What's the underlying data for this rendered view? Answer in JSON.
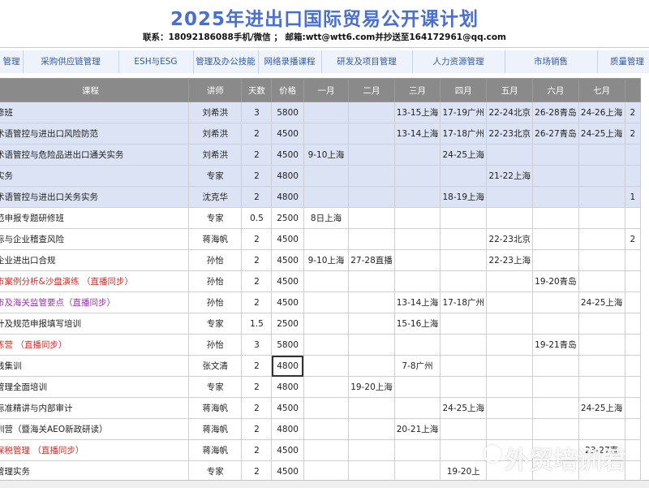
{
  "title": "2025年进出口国际贸易公开课计划",
  "contact": "联系：18092186088手机/微信 ； 邮箱:wtt@wtt6.com并抄送至164172961@qq.com",
  "tabs": [
    "管理",
    "采购供应链管理",
    "ESH与ESG",
    "管理及办公技能",
    "网络录播课程",
    "研发及项目管理",
    "人力资源管理",
    "市场销售",
    "质量管理"
  ],
  "headers": [
    "课程",
    "讲师",
    "天数",
    "价格",
    "一月",
    "二月",
    "三月",
    "四月",
    "五月",
    "六月",
    "七月",
    ""
  ],
  "rows": [
    {
      "course": "修班",
      "style": "",
      "blue": true,
      "cells": [
        "刘希洪",
        "3",
        "5800",
        "",
        "",
        "13-15上海",
        "17-19广州",
        "22-24北京",
        "26-28青岛",
        "24-26上海",
        "2"
      ]
    },
    {
      "course": "术语管控与进出口风险防范",
      "style": "",
      "blue": true,
      "cells": [
        "刘希洪",
        "2",
        "4500",
        "",
        "",
        "13-14上海",
        "17-18广州",
        "22-23北京",
        "26-27青岛",
        "24-25上海",
        "2"
      ]
    },
    {
      "course": "术语管控与危险品进出口通关实务",
      "style": "",
      "blue": true,
      "cells": [
        "刘希洪",
        "2",
        "4500",
        "9-10上海",
        "",
        "",
        "24-25上海",
        "",
        "",
        "",
        ""
      ]
    },
    {
      "course": "实务",
      "style": "",
      "blue": true,
      "cells": [
        "专家",
        "2",
        "4800",
        "",
        "",
        "",
        "",
        "21-22上海",
        "",
        "",
        ""
      ]
    },
    {
      "course": "术语管控与进出口关务实务",
      "style": "",
      "blue": true,
      "cells": [
        "沈克华",
        "2",
        "4800",
        "",
        "",
        "",
        "18-19上海",
        "",
        "",
        "",
        "1"
      ]
    },
    {
      "course": "范申报专题研修班",
      "style": "",
      "blue": false,
      "cells": [
        "专家",
        "0.5",
        "2500",
        "8日上海",
        "",
        "",
        "",
        "",
        "",
        "",
        ""
      ]
    },
    {
      "course": "际与企业稽查风险",
      "style": "",
      "blue": false,
      "cells": [
        "蒋海帆",
        "2",
        "4500",
        "",
        "",
        "",
        "",
        "22-23北京",
        "",
        "",
        "2"
      ]
    },
    {
      "course": "企业进出口合规",
      "style": "",
      "blue": false,
      "cells": [
        "孙怡",
        "2",
        "4500",
        "9-10上海",
        "27-28直播",
        "",
        "",
        "22-23上海",
        "",
        "",
        ""
      ]
    },
    {
      "course": "市案例分析&沙盘演练 （直播同步）",
      "style": "red",
      "blue": false,
      "cells": [
        "孙怡",
        "2",
        "4500",
        "",
        "",
        "",
        "",
        "",
        "19-20青岛",
        "",
        ""
      ]
    },
    {
      "course": "市及海关监管要点（直播同步）",
      "style": "purple",
      "blue": false,
      "cells": [
        "孙怡",
        "2",
        "4500",
        "",
        "",
        "13-14上海",
        "17-18广州",
        "",
        "",
        "24-25上海",
        ""
      ]
    },
    {
      "course": "计及规范申报填写培训",
      "style": "",
      "blue": false,
      "cells": [
        "专家",
        "1.5",
        "2500",
        "",
        "",
        "15-16上海",
        "",
        "",
        "",
        "",
        ""
      ]
    },
    {
      "course": "练营 （直播同步）",
      "style": "red",
      "blue": false,
      "cells": [
        "孙怡",
        "3",
        "5800",
        "",
        "",
        "",
        "",
        "",
        "19-21青岛",
        "",
        ""
      ]
    },
    {
      "course": "践集训",
      "style": "",
      "blue": false,
      "cells": [
        "张文清",
        "2",
        "4800",
        "",
        "",
        "7-8广州",
        "",
        "",
        "",
        "",
        ""
      ]
    },
    {
      "course": "管理全面培训",
      "style": "",
      "blue": false,
      "cells": [
        "专家",
        "2",
        "4800",
        "",
        "19-20上海",
        "",
        "",
        "",
        "",
        "",
        ""
      ]
    },
    {
      "course": "标准精讲与内部审计",
      "style": "",
      "blue": false,
      "cells": [
        "蒋海帆",
        "2",
        "4500",
        "",
        "",
        "",
        "24-25上海",
        "",
        "",
        "24-25上海",
        ""
      ]
    },
    {
      "course": "训营（暨海关AEO新政研读）",
      "style": "",
      "blue": false,
      "cells": [
        "蒋海帆",
        "2",
        "4800",
        "",
        "",
        "20-21上海",
        "",
        "",
        "",
        "",
        ""
      ]
    },
    {
      "course": "保税管理 （直播同步）",
      "style": "red",
      "blue": false,
      "cells": [
        "蒋海帆",
        "2",
        "4500",
        "",
        "",
        "",
        "",
        "",
        "",
        "23-27直",
        ""
      ]
    },
    {
      "course": "管理实务",
      "style": "",
      "blue": false,
      "cells": [
        "专家",
        "2",
        "4500",
        "",
        "",
        "",
        "19-20上",
        "",
        "",
        "",
        ""
      ]
    }
  ],
  "watermark": "外贸培训君",
  "watermark_icon": "chat-bubble-icon",
  "colors": {
    "title": "#4a6fd1",
    "tab_text": "#2f5aa8",
    "header_bg": "#8a8a8a",
    "row_blue": "#dbe3f5",
    "live_red": "#d0302a",
    "live_purple": "#a030b0"
  }
}
